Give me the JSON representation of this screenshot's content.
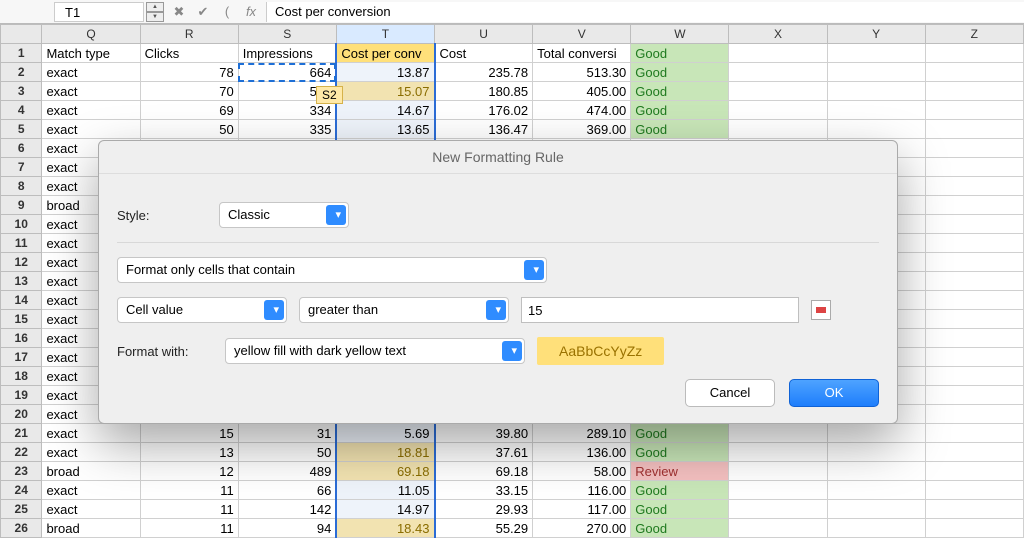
{
  "namebox": "T1",
  "formula_bar": "Cost per conversion",
  "columns": [
    "Q",
    "R",
    "S",
    "T",
    "U",
    "V",
    "W",
    "X",
    "Y",
    "Z"
  ],
  "header_row": {
    "Q": "Match type",
    "R": "Clicks",
    "S": "Impressions",
    "T": "Cost per conv",
    "U": "Cost",
    "V": "Total conversi",
    "W": "Good"
  },
  "tooltip_ref": "S2",
  "rows": [
    {
      "n": 2,
      "Q": "exact",
      "R": 78,
      "S": 664,
      "T": "13.87",
      "U": "235.78",
      "V": "513.30",
      "W": "Good",
      "Thi": false
    },
    {
      "n": 3,
      "Q": "exact",
      "R": 70,
      "S": 538,
      "T": "15.07",
      "U": "180.85",
      "V": "405.00",
      "W": "Good",
      "Thi": true
    },
    {
      "n": 4,
      "Q": "exact",
      "R": 69,
      "S": 334,
      "T": "14.67",
      "U": "176.02",
      "V": "474.00",
      "W": "Good",
      "Thi": false
    },
    {
      "n": 5,
      "Q": "exact",
      "R": 50,
      "S": 335,
      "T": "13.65",
      "U": "136.47",
      "V": "369.00",
      "W": "Good",
      "Thi": false
    },
    {
      "n": 6,
      "Q": "exact"
    },
    {
      "n": 7,
      "Q": "exact"
    },
    {
      "n": 8,
      "Q": "exact"
    },
    {
      "n": 9,
      "Q": "broad"
    },
    {
      "n": 10,
      "Q": "exact"
    },
    {
      "n": 11,
      "Q": "exact"
    },
    {
      "n": 12,
      "Q": "exact"
    },
    {
      "n": 13,
      "Q": "exact"
    },
    {
      "n": 14,
      "Q": "exact"
    },
    {
      "n": 15,
      "Q": "exact"
    },
    {
      "n": 16,
      "Q": "exact"
    },
    {
      "n": 17,
      "Q": "exact"
    },
    {
      "n": 18,
      "Q": "exact"
    },
    {
      "n": 19,
      "Q": "exact"
    },
    {
      "n": 20,
      "Q": "exact"
    },
    {
      "n": 21,
      "Q": "exact",
      "R": 15,
      "S": 31,
      "T": "5.69",
      "U": "39.80",
      "V": "289.10",
      "W": "Good",
      "Thi": false
    },
    {
      "n": 22,
      "Q": "exact",
      "R": 13,
      "S": 50,
      "T": "18.81",
      "U": "37.61",
      "V": "136.00",
      "W": "Good",
      "Thi": true
    },
    {
      "n": 23,
      "Q": "broad",
      "R": 12,
      "S": 489,
      "T": "69.18",
      "U": "69.18",
      "V": "58.00",
      "W": "Review",
      "Thi": true,
      "review": true
    },
    {
      "n": 24,
      "Q": "exact",
      "R": 11,
      "S": 66,
      "T": "11.05",
      "U": "33.15",
      "V": "116.00",
      "W": "Good",
      "Thi": false
    },
    {
      "n": 25,
      "Q": "exact",
      "R": 11,
      "S": 142,
      "T": "14.97",
      "U": "29.93",
      "V": "117.00",
      "W": "Good",
      "Thi": false
    },
    {
      "n": 26,
      "Q": "broad",
      "R": 11,
      "S": 94,
      "T": "18.43",
      "U": "55.29",
      "V": "270.00",
      "W": "Good",
      "Thi": true
    }
  ],
  "dialog": {
    "title": "New Formatting Rule",
    "style_label": "Style:",
    "style_value": "Classic",
    "rule_type": "Format only cells that contain",
    "condition_subject": "Cell value",
    "condition_op": "greater than",
    "condition_value": "15",
    "format_with_label": "Format with:",
    "format_with_value": "yellow fill with dark yellow text",
    "preview_text": "AaBbCcYyZz",
    "cancel": "Cancel",
    "ok": "OK"
  }
}
